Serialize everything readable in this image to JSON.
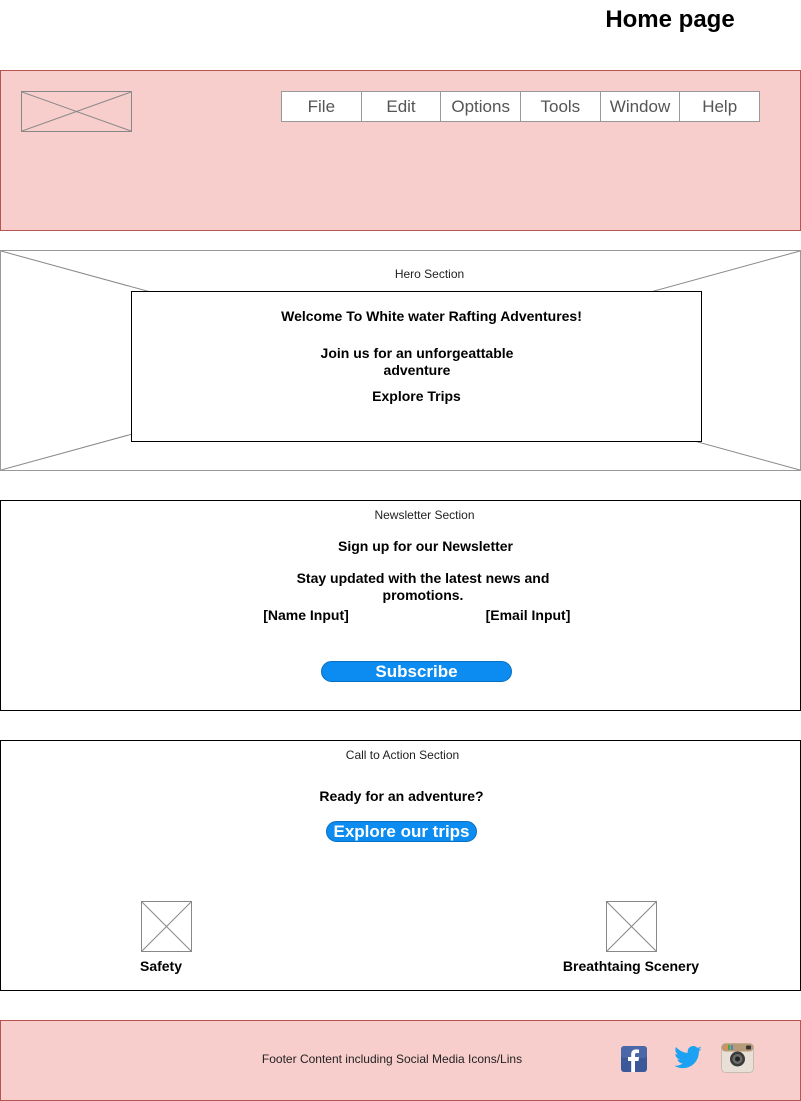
{
  "page_title": "Home page",
  "header": {
    "menu": [
      "File",
      "Edit",
      "Options",
      "Tools",
      "Window",
      "Help"
    ]
  },
  "hero": {
    "label": "Hero Section",
    "title": "Welcome To White water Rafting Adventures!",
    "subtitle": "Join us for an unforgeattable adventure",
    "cta": "Explore Trips"
  },
  "newsletter": {
    "label": "Newsletter Section",
    "title": "Sign up for our Newsletter",
    "subtitle": "Stay updated with the latest news and promotions.",
    "name_input": "[Name Input]",
    "email_input": "[Email Input]",
    "button": "Subscribe"
  },
  "cta": {
    "label": "Call to Action Section",
    "title": "Ready for an adventure?",
    "button": "Explore our trips",
    "features": [
      "Safety",
      "Breathtaing Scenery"
    ]
  },
  "footer": {
    "text": "Footer Content including Social Media Icons/Lins",
    "social_icons": [
      "facebook-icon",
      "twitter-icon",
      "instagram-icon"
    ]
  },
  "colors": {
    "header_bg": "#f8cecc",
    "button_bg": "#0c8cf0",
    "facebook": "#3b5998",
    "twitter": "#1da1f2"
  }
}
